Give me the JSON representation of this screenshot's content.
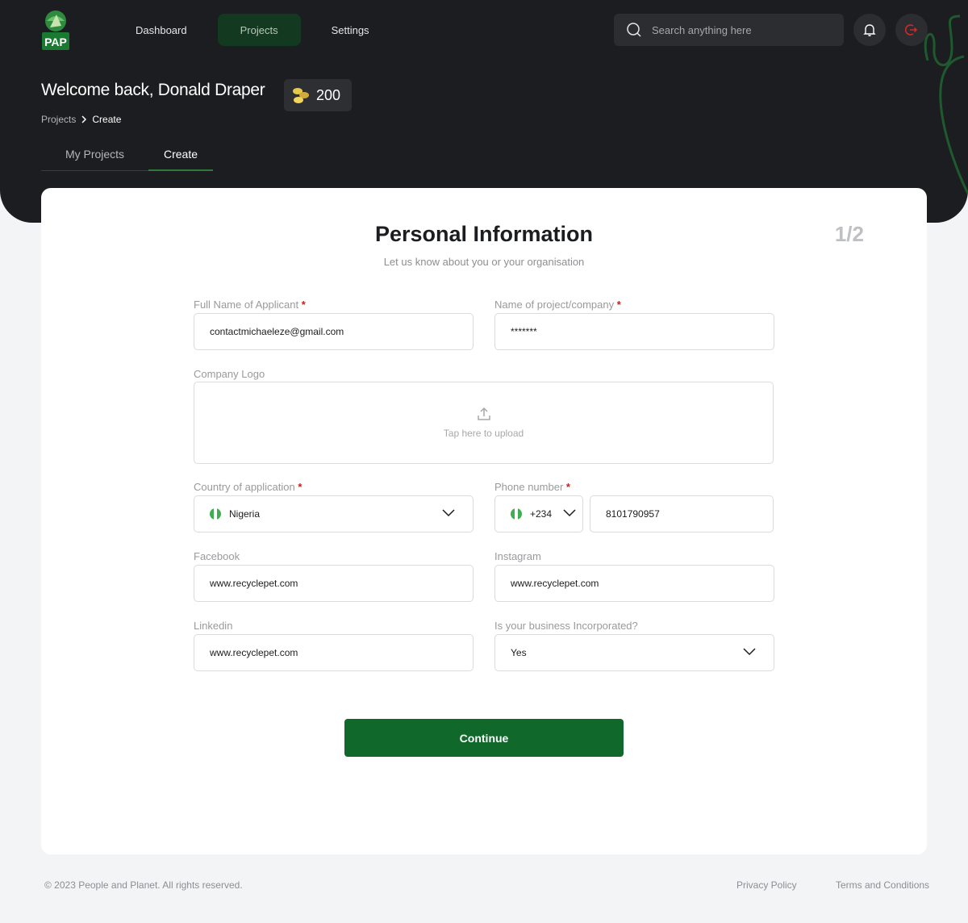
{
  "brand": {
    "logo_text": "PAP",
    "accent": "#10682a"
  },
  "nav": {
    "items": [
      {
        "label": "Dashboard"
      },
      {
        "label": "Projects"
      },
      {
        "label": "Settings"
      }
    ]
  },
  "search": {
    "placeholder": "Search anything here"
  },
  "header": {
    "welcome": "Welcome back, Donald Draper",
    "coins": "200",
    "breadcrumb": {
      "parent": "Projects",
      "current": "Create"
    },
    "tabs": [
      {
        "label": "My Projects"
      },
      {
        "label": "Create"
      }
    ]
  },
  "form": {
    "title": "Personal Information",
    "subtitle": "Let us know about you or your organisation",
    "step": "1/2",
    "full_name": {
      "label": "Full Name of Applicant",
      "value": "contactmichaeleze@gmail.com"
    },
    "project_name": {
      "label": "Name of project/company",
      "value": "*******"
    },
    "logo": {
      "label": "Company Logo",
      "upload_text": "Tap here to upload"
    },
    "country": {
      "label": "Country of application",
      "value": "Nigeria"
    },
    "phone": {
      "label": "Phone number",
      "code": "+234",
      "value": "8101790957"
    },
    "facebook": {
      "label": "Facebook",
      "value": "www.recyclepet.com"
    },
    "instagram": {
      "label": "Instagram",
      "value": "www.recyclepet.com"
    },
    "linkedin": {
      "label": "Linkedin",
      "value": "www.recyclepet.com"
    },
    "incorporated": {
      "label": "Is your business Incorporated?",
      "value": "Yes"
    },
    "required_mark": "*",
    "continue_label": "Continue"
  },
  "footer": {
    "copyright": "© 2023 People and Planet. All rights reserved.",
    "privacy": "Privacy Policy",
    "terms": "Terms and Conditions"
  }
}
